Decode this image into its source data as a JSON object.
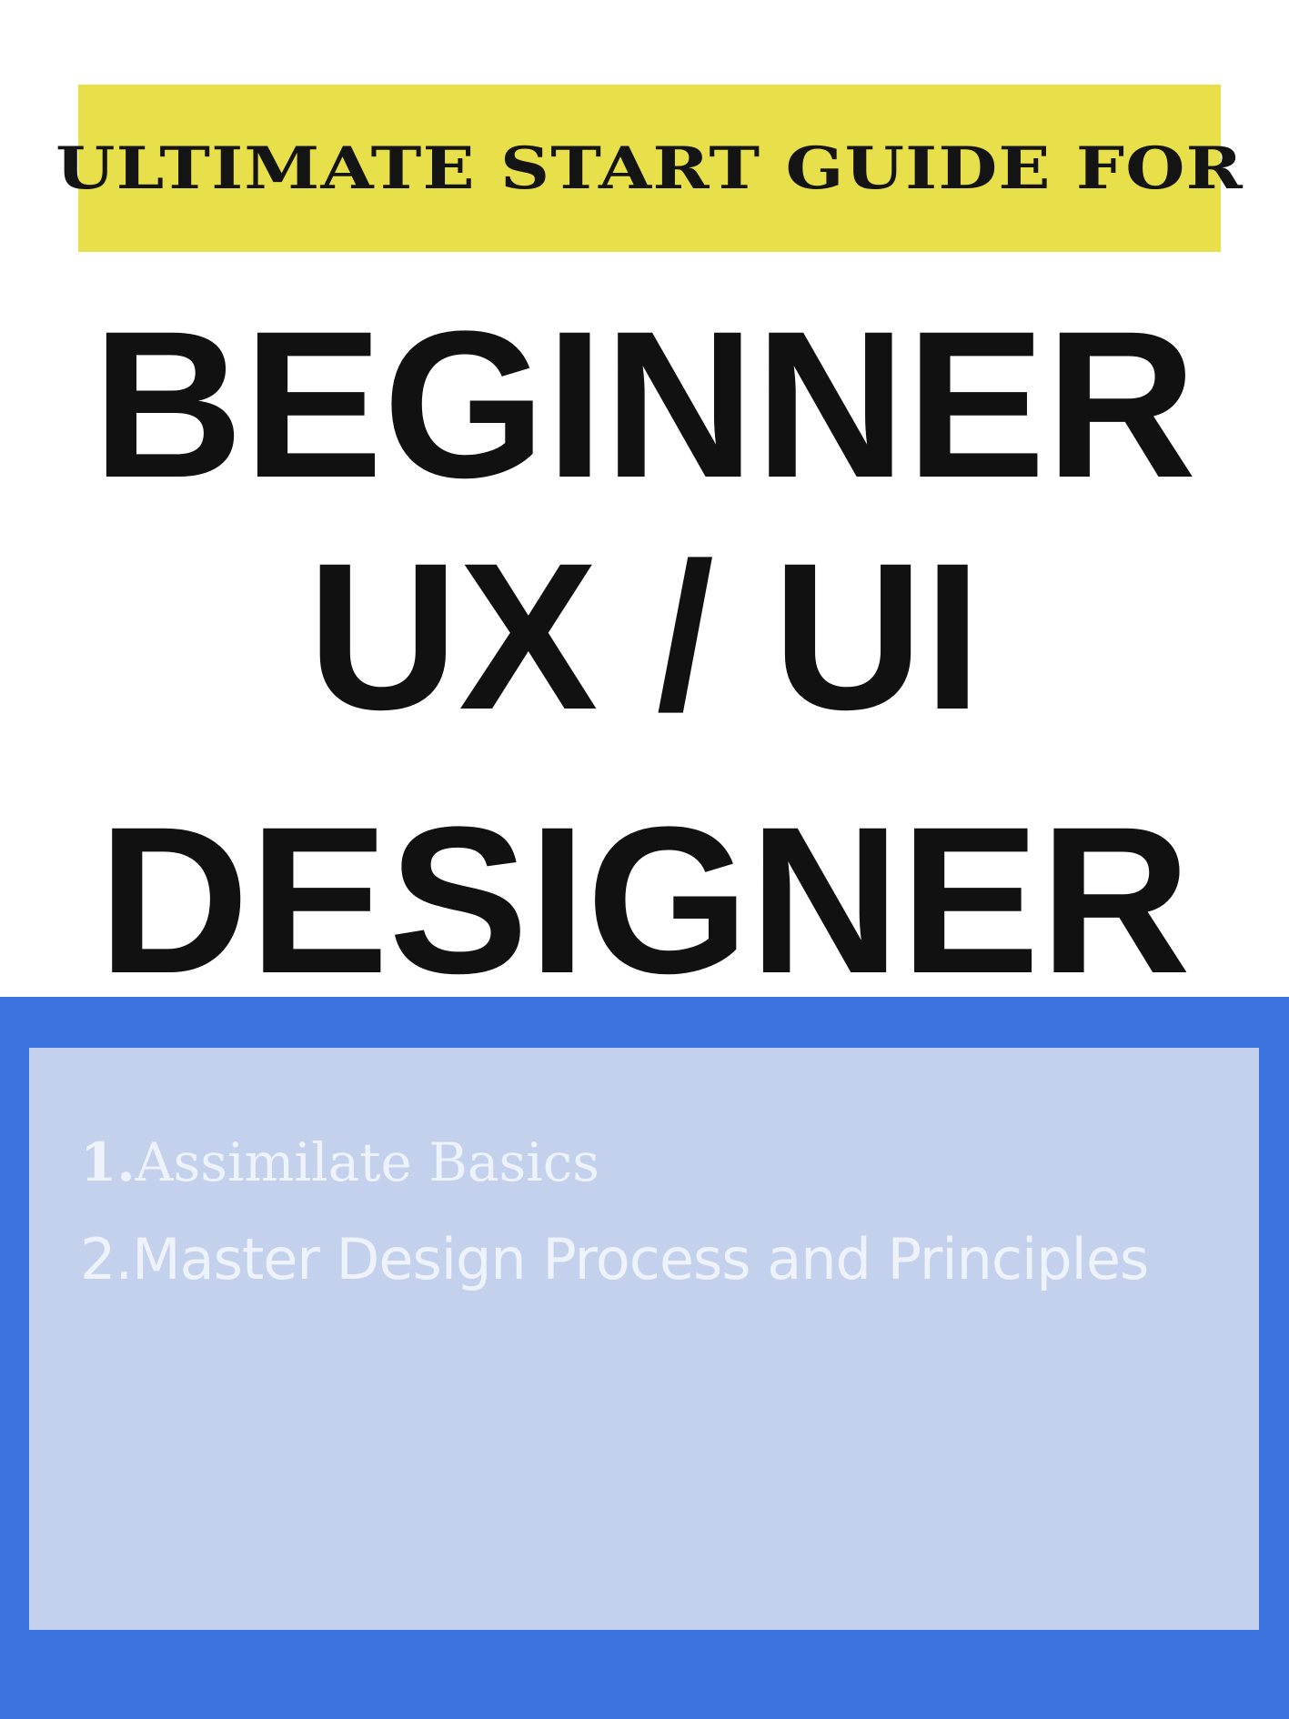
{
  "banner": {
    "text": "ULTIMATE START GUIDE FOR"
  },
  "title": {
    "line1": "BEGINNER",
    "line2": "UX / UI",
    "line3": "DESIGNER"
  },
  "list": {
    "item1_number": "1.",
    "item1_text": "Assimilate Basics",
    "item2": "2.Master Design Process and Principles"
  },
  "colors": {
    "banner_bg": "#e8e04b",
    "title_text": "#111111",
    "outer_panel": "#3b72de",
    "inner_panel": "#c3d1ec",
    "list_text": "#eef2fb"
  }
}
